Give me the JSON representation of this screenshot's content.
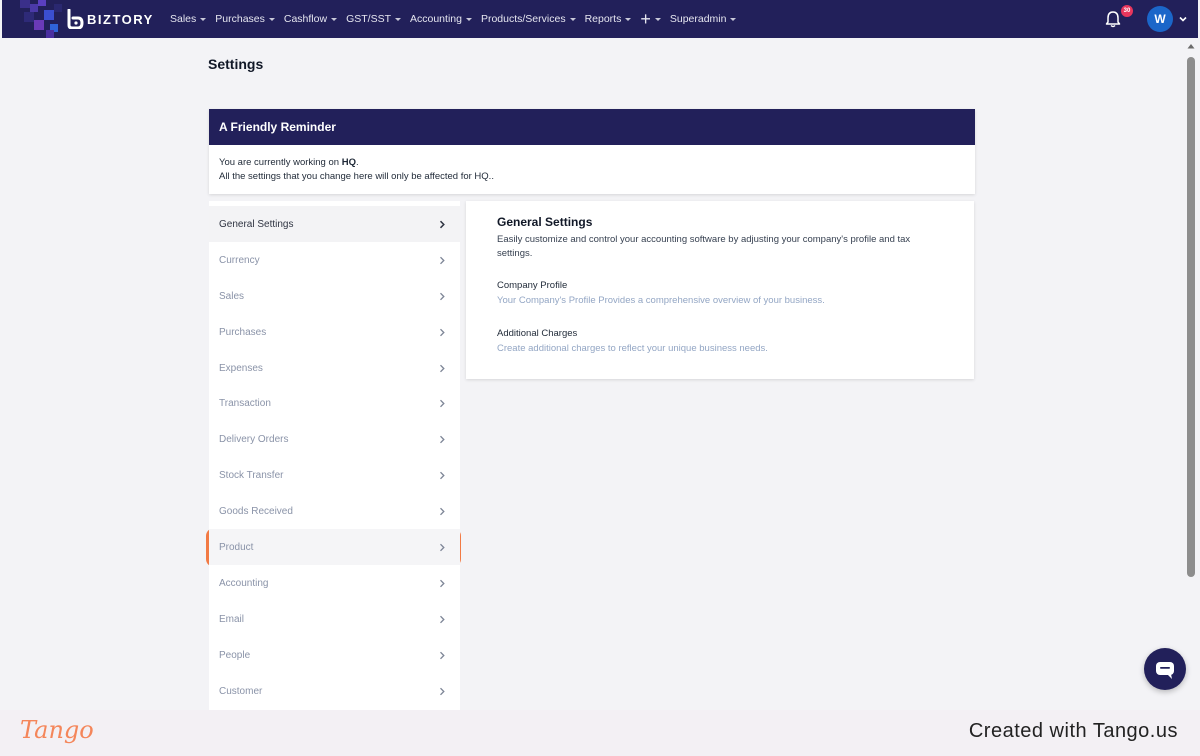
{
  "app": {
    "brand": "BIZTORY",
    "colors": {
      "nav_bg": "#22205a",
      "accent": "#f27a44",
      "avatar": "#1b66c9",
      "badge": "#e8365d"
    }
  },
  "nav": {
    "items": [
      {
        "label": "Sales"
      },
      {
        "label": "Purchases"
      },
      {
        "label": "Cashflow"
      },
      {
        "label": "GST/SST"
      },
      {
        "label": "Accounting"
      },
      {
        "label": "Products/Services"
      },
      {
        "label": "Reports"
      },
      {
        "label": "+"
      },
      {
        "label": "Superadmin"
      }
    ],
    "notification_count": "30",
    "avatar_initial": "W"
  },
  "page": {
    "title": "Settings"
  },
  "reminder": {
    "title": "A Friendly Reminder",
    "line1_prefix": "You are currently working on ",
    "location": "HQ",
    "line1_suffix": ".",
    "line2": "All the settings that you change here will only be affected for HQ.."
  },
  "sidebar": {
    "items": [
      {
        "label": "General Settings"
      },
      {
        "label": "Currency"
      },
      {
        "label": "Sales"
      },
      {
        "label": "Purchases"
      },
      {
        "label": "Expenses"
      },
      {
        "label": "Transaction"
      },
      {
        "label": "Delivery Orders"
      },
      {
        "label": "Stock Transfer"
      },
      {
        "label": "Goods Received"
      },
      {
        "label": "Product"
      },
      {
        "label": "Accounting"
      },
      {
        "label": "Email"
      },
      {
        "label": "People"
      },
      {
        "label": "Customer"
      }
    ]
  },
  "content": {
    "title": "General Settings",
    "description": "Easily customize and control your accounting software by adjusting your company's profile and tax settings.",
    "sections": [
      {
        "title": "Company Profile",
        "description": "Your Company's Profile Provides a comprehensive overview of your business."
      },
      {
        "title": "Additional Charges",
        "description": "Create additional charges to reflect your unique business needs."
      }
    ]
  },
  "footer": {
    "logo": "Tango",
    "credit": "Created with Tango.us"
  }
}
